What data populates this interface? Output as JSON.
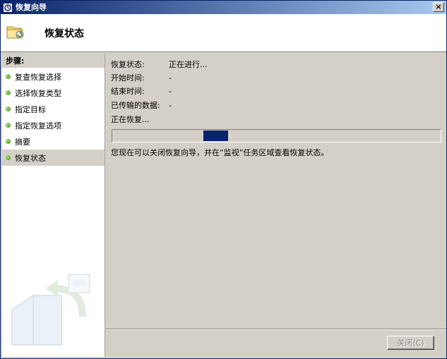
{
  "window": {
    "title": "恢复向导",
    "close_glyph": "×"
  },
  "header": {
    "title": "恢复状态"
  },
  "steps": {
    "title": "步骤:",
    "items": [
      {
        "label": "复查恢复选择",
        "active": false
      },
      {
        "label": "选择恢复类型",
        "active": false
      },
      {
        "label": "指定目标",
        "active": false
      },
      {
        "label": "指定恢复选项",
        "active": false
      },
      {
        "label": "摘要",
        "active": false
      },
      {
        "label": "恢复状态",
        "active": true
      }
    ]
  },
  "status": {
    "status_label": "恢复状态:",
    "status_value": "正在进行...",
    "start_label": "开始时间:",
    "start_value": "-",
    "end_label": "结束时间:",
    "end_value": "-",
    "transferred_label": "已传输的数据:",
    "transferred_value": "-",
    "progress_text": "正在恢复...",
    "message": "您现在可以关闭恢复向导，并在“监视”任务区域查看恢复状态。"
  },
  "footer": {
    "close_label": "关闭(C)"
  },
  "colors": {
    "titlebar": "#0a246a",
    "accent": "#0a246a",
    "step_dot": "#3a8a1a"
  }
}
